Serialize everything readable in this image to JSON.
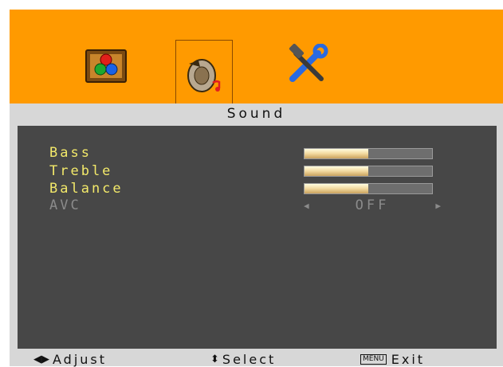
{
  "tabs": [
    {
      "icon": "picture-icon",
      "selected": false
    },
    {
      "icon": "sound-icon",
      "selected": true
    },
    {
      "icon": "setup-tools-icon",
      "selected": false
    }
  ],
  "page_title": "Sound",
  "items": [
    {
      "label": "Bass",
      "value_fraction": 0.5,
      "enabled": true
    },
    {
      "label": "Treble",
      "value_fraction": 0.5,
      "enabled": true
    },
    {
      "label": "Balance",
      "value_fraction": 0.5,
      "enabled": true
    },
    {
      "label": "AVC",
      "value": "OFF",
      "enabled": false
    }
  ],
  "footer": {
    "adjust_label": "Adjust",
    "select_label": "Select",
    "menu_key": "MENU",
    "exit_label": "Exit"
  },
  "colors": {
    "header": "#ff9a00",
    "panel": "#474747",
    "item_text": "#f3e96a",
    "disabled_text": "#8b8b8b"
  }
}
